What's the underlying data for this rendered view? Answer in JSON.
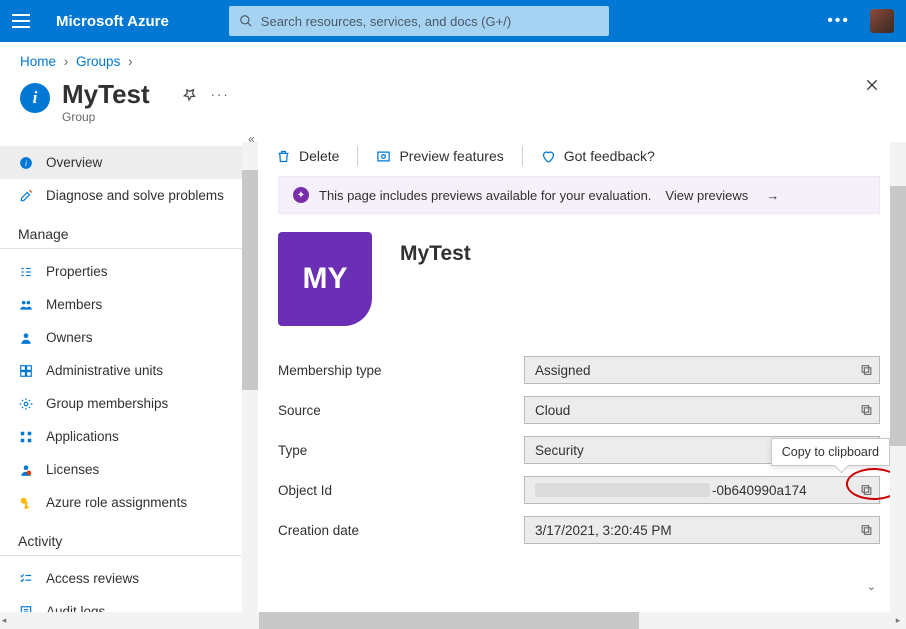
{
  "brand": "Microsoft Azure",
  "search": {
    "placeholder": "Search resources, services, and docs (G+/)"
  },
  "breadcrumb": {
    "home": "Home",
    "groups": "Groups"
  },
  "page": {
    "title": "MyTest",
    "subtitle": "Group"
  },
  "sidebar": {
    "overview": "Overview",
    "diagnose": "Diagnose and solve problems",
    "manage_header": "Manage",
    "properties": "Properties",
    "members": "Members",
    "owners": "Owners",
    "admin_units": "Administrative units",
    "group_memberships": "Group memberships",
    "applications": "Applications",
    "licenses": "Licenses",
    "role_assignments": "Azure role assignments",
    "activity_header": "Activity",
    "access_reviews": "Access reviews",
    "audit_logs": "Audit logs"
  },
  "commands": {
    "delete": "Delete",
    "preview": "Preview features",
    "feedback": "Got feedback?"
  },
  "banner": {
    "text": "This page includes previews available for your evaluation.",
    "link": "View previews"
  },
  "group": {
    "name": "MyTest",
    "avatar": "MY"
  },
  "fields": {
    "membership_label": "Membership type",
    "membership_value": "Assigned",
    "source_label": "Source",
    "source_value": "Cloud",
    "type_label": "Type",
    "type_value": "Security",
    "objectid_label": "Object Id",
    "objectid_value_suffix": "-0b640990a174",
    "creation_label": "Creation date",
    "creation_value": "3/17/2021, 3:20:45 PM"
  },
  "tooltip": "Copy to clipboard"
}
